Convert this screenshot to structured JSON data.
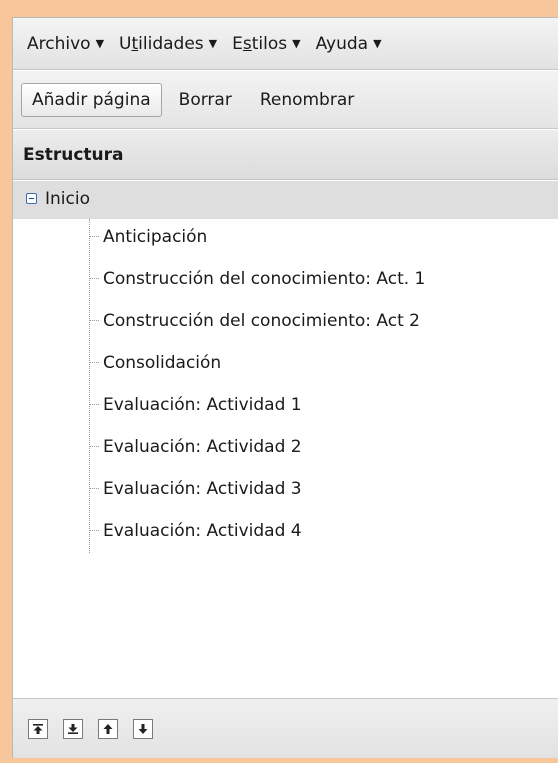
{
  "menubar": {
    "items": [
      {
        "label": "Archivo"
      },
      {
        "label_pre": "U",
        "label_u": "t",
        "label_post": "ilidades"
      },
      {
        "label_pre": "E",
        "label_u": "s",
        "label_post": "tilos"
      },
      {
        "label": "Ayuda"
      }
    ]
  },
  "toolbar": {
    "add_label": "Añadir página",
    "delete_label": "Borrar",
    "rename_label": "Renombrar"
  },
  "structure": {
    "header": "Estructura",
    "root_label": "Inicio",
    "items": [
      {
        "label": "Anticipación"
      },
      {
        "label": "Construcción del conocimiento: Act. 1"
      },
      {
        "label": "Construcción del conocimiento: Act 2"
      },
      {
        "label": "Consolidación"
      },
      {
        "label": "Evaluación: Actividad 1"
      },
      {
        "label": "Evaluación: Actividad 2"
      },
      {
        "label": "Evaluación: Actividad 3"
      },
      {
        "label": "Evaluación: Actividad 4"
      }
    ]
  },
  "footer": {
    "buttons": [
      {
        "icon": "move-top-icon"
      },
      {
        "icon": "move-bottom-icon"
      },
      {
        "icon": "move-up-icon"
      },
      {
        "icon": "move-down-icon"
      }
    ]
  }
}
